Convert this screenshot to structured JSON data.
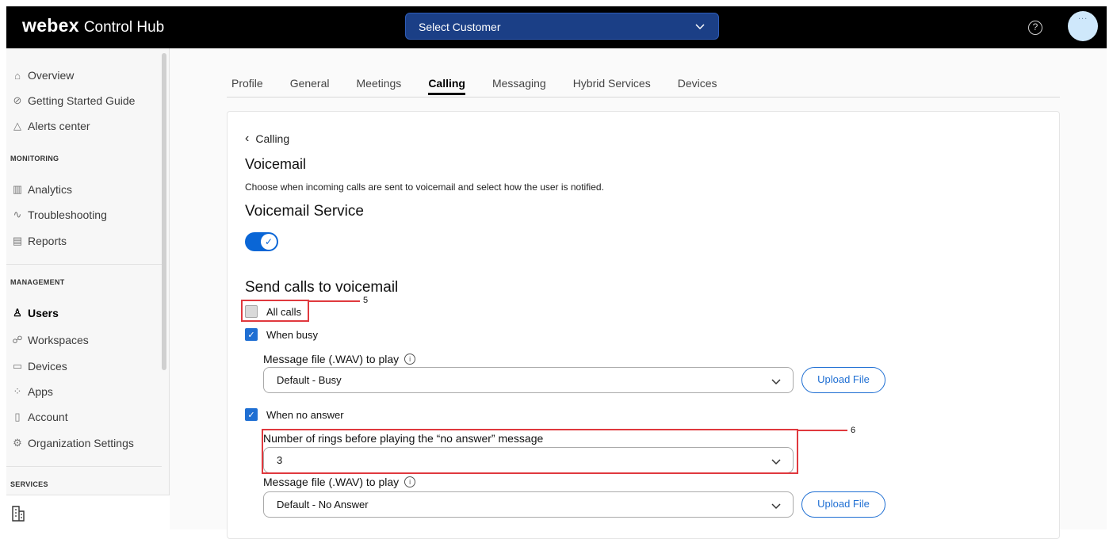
{
  "topbar": {
    "brand": "webex",
    "product": "Control Hub",
    "customer_select": "Select Customer",
    "help_icon": "help-circle-icon",
    "avatar_text": "..."
  },
  "sidebar": {
    "items_top": [
      {
        "label": "Overview",
        "icon": "home-icon"
      },
      {
        "label": "Getting Started Guide",
        "icon": "check-circle-icon"
      },
      {
        "label": "Alerts center",
        "icon": "bell-icon"
      }
    ],
    "monitoring_heading": "MONITORING",
    "items_monitoring": [
      {
        "label": "Analytics",
        "icon": "analytics-icon"
      },
      {
        "label": "Troubleshooting",
        "icon": "pulse-icon"
      },
      {
        "label": "Reports",
        "icon": "report-icon"
      }
    ],
    "management_heading": "MANAGEMENT",
    "items_management": [
      {
        "label": "Users",
        "icon": "user-icon"
      },
      {
        "label": "Workspaces",
        "icon": "workspaces-icon"
      },
      {
        "label": "Devices",
        "icon": "device-icon"
      },
      {
        "label": "Apps",
        "icon": "apps-icon"
      },
      {
        "label": "Account",
        "icon": "account-icon"
      },
      {
        "label": "Organization Settings",
        "icon": "gear-icon"
      }
    ],
    "services_heading": "SERVICES"
  },
  "tabs": [
    "Profile",
    "General",
    "Meetings",
    "Calling",
    "Messaging",
    "Hybrid Services",
    "Devices"
  ],
  "active_tab": "Calling",
  "content": {
    "back_label": "Calling",
    "title": "Voicemail",
    "description": "Choose when incoming calls are sent to voicemail and select how the user is notified.",
    "service_heading": "Voicemail Service",
    "send_heading": "Send calls to voicemail",
    "all_calls": "All calls",
    "when_busy": "When busy",
    "busy_message_label": "Message file (.WAV) to play",
    "busy_message_value": "Default - Busy",
    "upload_label": "Upload File",
    "when_no_answer": "When no answer",
    "rings_label": "Number of rings before playing the “no answer” message",
    "rings_value": "3",
    "noanswer_message_label": "Message file (.WAV) to play",
    "noanswer_message_value": "Default - No Answer"
  },
  "callouts": {
    "five": "5",
    "six": "6"
  },
  "colors": {
    "accent": "#1f6fd3",
    "highlight": "#e0393e",
    "topbar": "#000000"
  }
}
